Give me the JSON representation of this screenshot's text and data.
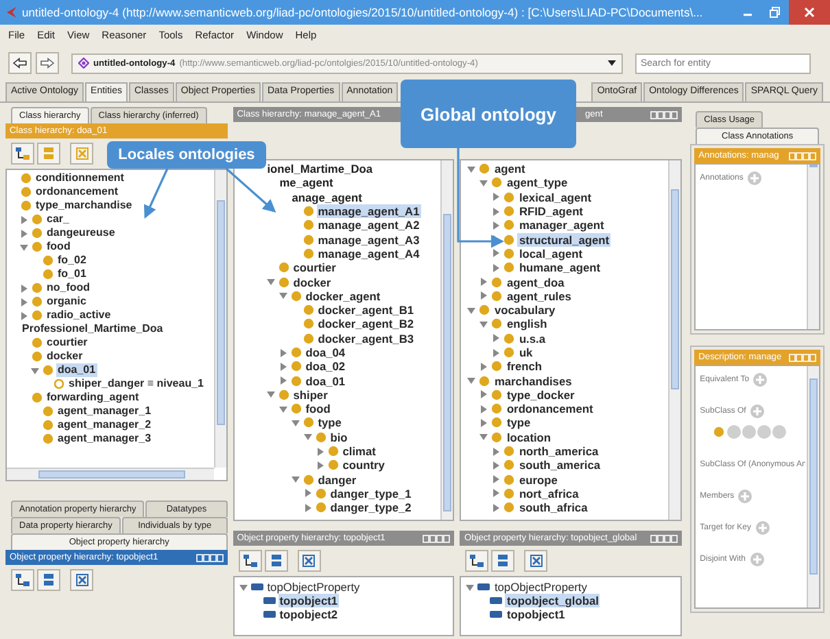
{
  "window": {
    "title": "untitled-ontology-4 (http://www.semanticweb.org/liad-pc/ontologies/2015/10/untitled-ontology-4) : [C:\\Users\\LIAD-PC\\Documents\\..."
  },
  "menu": [
    "File",
    "Edit",
    "View",
    "Reasoner",
    "Tools",
    "Refactor",
    "Window",
    "Help"
  ],
  "address": {
    "name": "untitled-ontology-4",
    "iri": "(http://www.semanticweb.org/liad-pc/ontolgies/2015/10/untitled-ontology-4)"
  },
  "search": {
    "placeholder": "Search for entity"
  },
  "tabs": [
    {
      "label": "Active Ontology",
      "selected": false
    },
    {
      "label": "Entities",
      "selected": true
    },
    {
      "label": "Classes",
      "selected": false
    },
    {
      "label": "Object Properties",
      "selected": false
    },
    {
      "label": "Data Properties",
      "selected": false
    },
    {
      "label": "Annotation",
      "selected": false
    }
  ],
  "more_tabs": [
    {
      "label": "OntoGraf",
      "selected": false
    },
    {
      "label": "Ontology Differences",
      "selected": false
    },
    {
      "label": "SPARQL Query",
      "selected": false
    }
  ],
  "left": {
    "tabs": [
      {
        "label": "Class hierarchy",
        "selected": true
      },
      {
        "label": "Class hierarchy (inferred)",
        "selected": false
      }
    ],
    "header": {
      "text": "Class hierarchy: doa_01",
      "kind": "highlighted"
    },
    "tree": [
      {
        "label": "conditionnement",
        "kind": "class",
        "selected": false
      },
      {
        "label": "ordonancement",
        "kind": "class",
        "selected": false
      },
      {
        "label": "type_marchandise",
        "kind": "class",
        "selected": false,
        "children": [
          {
            "label": "car_",
            "expanded": false,
            "kind": "class",
            "selected": false
          },
          {
            "label": "dangeureuse",
            "expanded": false,
            "kind": "class",
            "selected": false
          },
          {
            "label": "food",
            "expanded": true,
            "kind": "class",
            "selected": false,
            "children": [
              {
                "label": "fo_02",
                "kind": "class",
                "selected": false
              },
              {
                "label": "fo_01",
                "kind": "class",
                "selected": false
              }
            ]
          },
          {
            "label": "no_food",
            "expanded": false,
            "kind": "class",
            "selected": false
          },
          {
            "label": "organic",
            "expanded": false,
            "kind": "class",
            "selected": false
          },
          {
            "label": "radio_active",
            "expanded": false,
            "kind": "class",
            "selected": false
          }
        ]
      },
      {
        "label": "Professionel_Martime_Doa",
        "kind": "plain",
        "selected": false,
        "children": [
          {
            "label": "courtier",
            "kind": "class",
            "selected": false
          },
          {
            "label": "docker",
            "kind": "class",
            "selected": false,
            "children": [
              {
                "label": "doa_01",
                "expanded": true,
                "kind": "class",
                "selected": true,
                "children": [
                  {
                    "label": "shiper_danger ≡ niveau_1",
                    "kind": "defined",
                    "selected": false
                  }
                ]
              }
            ]
          },
          {
            "label": "forwarding_agent",
            "kind": "class",
            "selected": false,
            "children": [
              {
                "label": "agent_manager_1",
                "kind": "class",
                "selected": false
              },
              {
                "label": "agent_manager_2",
                "kind": "class",
                "selected": false
              },
              {
                "label": "agent_manager_3",
                "kind": "class",
                "selected": false
              }
            ]
          }
        ]
      }
    ]
  },
  "middle": {
    "header": {
      "text": "Class hierarchy: manage_agent_A1",
      "kind": "plain"
    },
    "tree": [
      {
        "label": "ionel_Martime_Doa",
        "kind": "plain",
        "selected": false,
        "children": [
          {
            "label": "me_agent",
            "kind": "plain",
            "selected": false,
            "children": [
              {
                "label": "anage_agent",
                "kind": "plain",
                "selected": false,
                "children": [
                  {
                    "label": "manage_agent_A1",
                    "kind": "class",
                    "selected": true
                  },
                  {
                    "label": "manage_agent_A2",
                    "kind": "class",
                    "selected": false
                  },
                  {
                    "label": "manage_agent_A3",
                    "kind": "class",
                    "selected": false
                  },
                  {
                    "label": "manage_agent_A4",
                    "kind": "class",
                    "selected": false
                  }
                ]
              }
            ]
          },
          {
            "label": "courtier",
            "kind": "class",
            "selected": false
          },
          {
            "label": "docker",
            "expanded": true,
            "kind": "class",
            "selected": false,
            "children": [
              {
                "label": "docker_agent",
                "expanded": true,
                "kind": "class",
                "selected": false,
                "children": [
                  {
                    "label": "docker_agent_B1",
                    "kind": "class",
                    "selected": false
                  },
                  {
                    "label": "docker_agent_B2",
                    "kind": "class",
                    "selected": false
                  },
                  {
                    "label": "docker_agent_B3",
                    "kind": "class",
                    "selected": false
                  }
                ]
              },
              {
                "label": "doa_04",
                "expanded": false,
                "kind": "class",
                "selected": false
              },
              {
                "label": "doa_02",
                "expanded": false,
                "kind": "class",
                "selected": false
              },
              {
                "label": "doa_01",
                "expanded": false,
                "kind": "class",
                "selected": false
              }
            ]
          },
          {
            "label": "shiper",
            "expanded": true,
            "kind": "class",
            "selected": false,
            "children": [
              {
                "label": "food",
                "expanded": true,
                "kind": "class",
                "selected": false,
                "children": [
                  {
                    "label": "type",
                    "expanded": true,
                    "kind": "class",
                    "selected": false,
                    "children": [
                      {
                        "label": "bio",
                        "expanded": true,
                        "kind": "class",
                        "selected": false,
                        "children": [
                          {
                            "label": "climat",
                            "expanded": false,
                            "kind": "class",
                            "selected": false
                          },
                          {
                            "label": "country",
                            "expanded": false,
                            "kind": "class",
                            "selected": false
                          }
                        ]
                      }
                    ]
                  },
                  {
                    "label": "danger",
                    "expanded": true,
                    "kind": "class",
                    "selected": false,
                    "children": [
                      {
                        "label": "danger_type_1",
                        "expanded": false,
                        "kind": "class",
                        "selected": false
                      },
                      {
                        "label": "danger_type_2",
                        "expanded": false,
                        "kind": "class",
                        "selected": false
                      }
                    ]
                  }
                ]
              }
            ]
          }
        ]
      }
    ]
  },
  "global": {
    "header": {
      "text": "gent",
      "kind": "plain"
    },
    "tree": [
      {
        "label": "agent",
        "expanded": true,
        "kind": "class",
        "selected": false,
        "children": [
          {
            "label": "agent_type",
            "expanded": true,
            "kind": "class",
            "selected": false,
            "children": [
              {
                "label": "lexical_agent",
                "expanded": false,
                "kind": "class",
                "selected": false
              },
              {
                "label": "RFID_agent",
                "expanded": false,
                "kind": "class",
                "selected": false
              },
              {
                "label": "manager_agent",
                "expanded": false,
                "kind": "class",
                "selected": false
              },
              {
                "label": "structural_agent",
                "expanded": false,
                "kind": "class",
                "selected": true
              },
              {
                "label": "local_agent",
                "expanded": false,
                "kind": "class",
                "selected": false
              },
              {
                "label": "humane_agent",
                "expanded": false,
                "kind": "class",
                "selected": false
              }
            ]
          },
          {
            "label": "agent_doa",
            "expanded": false,
            "kind": "class",
            "selected": false
          },
          {
            "label": "agent_rules",
            "expanded": false,
            "kind": "class",
            "selected": false
          }
        ]
      },
      {
        "label": "vocabulary",
        "expanded": true,
        "kind": "class",
        "selected": false,
        "children": [
          {
            "label": "english",
            "expanded": true,
            "kind": "class",
            "selected": false,
            "children": [
              {
                "label": "u.s.a",
                "expanded": false,
                "kind": "class",
                "selected": false
              },
              {
                "label": "uk",
                "expanded": false,
                "kind": "class",
                "selected": false
              }
            ]
          },
          {
            "label": "french",
            "expanded": false,
            "kind": "class",
            "selected": false
          }
        ]
      },
      {
        "label": "marchandises",
        "expanded": true,
        "kind": "class",
        "selected": false,
        "children": [
          {
            "label": "type_docker",
            "expanded": false,
            "kind": "class",
            "selected": false
          },
          {
            "label": "ordonancement",
            "expanded": false,
            "kind": "class",
            "selected": false
          },
          {
            "label": "type",
            "expanded": false,
            "kind": "class",
            "selected": false
          },
          {
            "label": "location",
            "expanded": true,
            "kind": "class",
            "selected": false,
            "children": [
              {
                "label": "north_america",
                "expanded": false,
                "kind": "class",
                "selected": false
              },
              {
                "label": "south_america",
                "expanded": false,
                "kind": "class",
                "selected": false
              },
              {
                "label": "europe",
                "expanded": false,
                "kind": "class",
                "selected": false
              },
              {
                "label": "nort_africa",
                "expanded": false,
                "kind": "class",
                "selected": false
              },
              {
                "label": "south_africa",
                "expanded": false,
                "kind": "class",
                "selected": false
              }
            ]
          }
        ]
      }
    ]
  },
  "property_tabs": [
    [
      {
        "label": "Annotation property hierarchy",
        "selected": false
      },
      {
        "label": "Datatypes",
        "selected": false
      }
    ],
    [
      {
        "label": "Data property hierarchy",
        "selected": false
      },
      {
        "label": "Individuals by type",
        "selected": false
      }
    ],
    [
      {
        "label": "Object property hierarchy",
        "selected": true
      }
    ]
  ],
  "left_property": {
    "header": {
      "text": "Object property hierarchy: topobject1",
      "kind": "focused"
    }
  },
  "middle_property": {
    "header": {
      "text": "Object property hierarchy: topobject1",
      "kind": "plain"
    },
    "tree": [
      {
        "label": "topObjectProperty",
        "expanded": true,
        "kind": "top",
        "selected": false,
        "children": [
          {
            "label": "topobject1",
            "kind": "property",
            "selected": true
          },
          {
            "label": "topobject2",
            "kind": "property",
            "selected": false
          }
        ]
      }
    ]
  },
  "global_property": {
    "header": {
      "text": "Object property hierarchy: topobject_global",
      "kind": "plain"
    },
    "tree": [
      {
        "label": "topObjectProperty",
        "expanded": true,
        "kind": "top",
        "selected": false,
        "children": [
          {
            "label": "topobject_global",
            "kind": "property",
            "selected": true
          },
          {
            "label": "topobject1",
            "kind": "property",
            "selected": false
          }
        ]
      }
    ]
  },
  "usage": {
    "tabs": [
      {
        "label": "Class Usage",
        "selected": false
      },
      {
        "label": "Class Annotations",
        "selected": true
      }
    ],
    "annotations": {
      "header": {
        "text": "Annotations: manag",
        "kind": "highlighted"
      },
      "sections": [
        {
          "kind": "heading",
          "label": "Annotations"
        }
      ]
    },
    "description": {
      "header": {
        "text": "Description: manage",
        "kind": "highlighted"
      },
      "sections": [
        {
          "kind": "heading",
          "label": "Equivalent To"
        },
        {
          "kind": "heading",
          "label": "SubClass Of"
        },
        {
          "kind": "entry"
        },
        {
          "kind": "label",
          "label": "SubClass Of (Anonymous An"
        },
        {
          "kind": "heading",
          "label": "Members"
        },
        {
          "kind": "heading",
          "label": "Target for Key"
        },
        {
          "kind": "heading",
          "label": "Disjoint With"
        }
      ]
    }
  },
  "callouts": [
    {
      "kind": "locales",
      "text": "Locales ontologies"
    },
    {
      "kind": "global",
      "text": "Global ontology"
    }
  ]
}
